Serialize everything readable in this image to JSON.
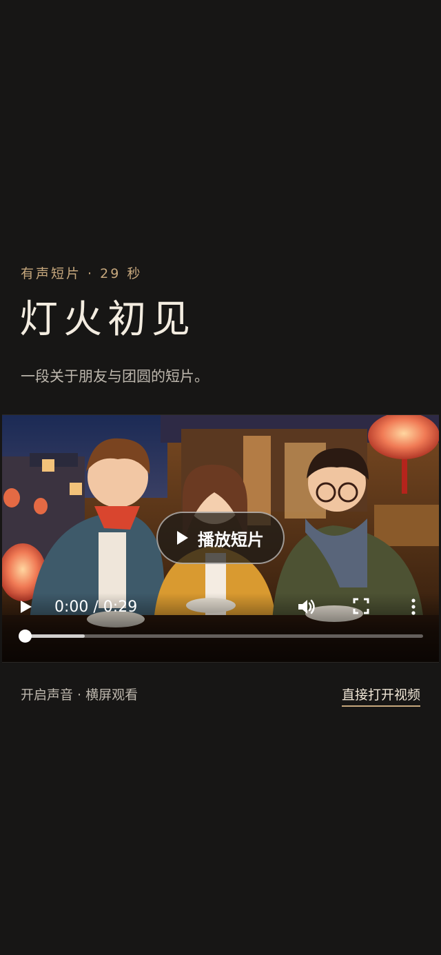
{
  "header": {
    "eyebrow": "有声短片 · 29 秒",
    "title": "灯火初见",
    "subtitle": "一段关于朋友与团圆的短片。"
  },
  "video": {
    "overlay_play_label": "播放短片",
    "time_display": "0:00 / 0:29",
    "progress_fraction": 0.0,
    "buffered_fraction": 0.15
  },
  "footer": {
    "hint": "开启声音 · 横屏观看",
    "open_video_link": "直接打开视频"
  },
  "colors": {
    "background": "#171615",
    "accent": "#c8a97e",
    "title": "#f3ece0"
  }
}
